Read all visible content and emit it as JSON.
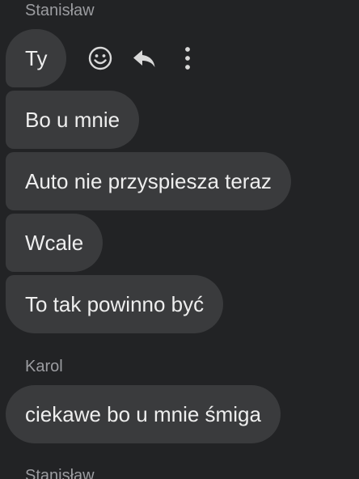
{
  "groups": [
    {
      "sender": "Stanisław",
      "messages": [
        "Ty",
        "Bo u mnie",
        "Auto nie przyspiesza teraz",
        "Wcale",
        "To tak powinno być"
      ]
    },
    {
      "sender": "Karol",
      "messages": [
        "ciekawe bo u mnie śmiga"
      ]
    },
    {
      "sender": "Stanisław",
      "messages": []
    }
  ],
  "actions": {
    "react_icon": "smiley-icon",
    "reply_icon": "reply-icon",
    "more_icon": "more-vertical-icon"
  },
  "colors": {
    "background": "#222325",
    "bubble": "#3a3b3d",
    "text": "#eeeeee",
    "sender": "#9b9ca0",
    "icon": "#d9d9d9"
  }
}
